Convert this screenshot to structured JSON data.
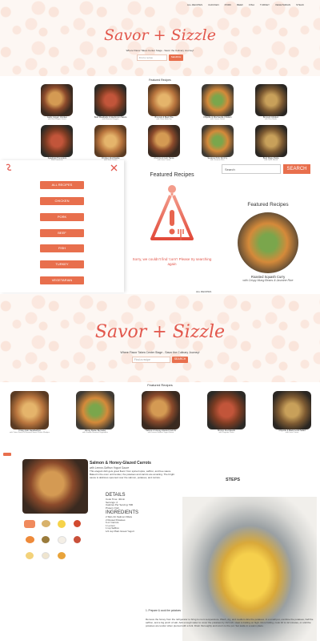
{
  "nav": {
    "items": [
      "ALL RECIPES",
      "CHICKEN",
      "PORK",
      "BEEF",
      "FISH",
      "TURKEY",
      "VEGETARIAN",
      "STEAK"
    ]
  },
  "hero": {
    "logo": "Savor + Sizzle",
    "tagline": "Where Flavor Takes Center Stage - Savor the Culinary Journey!",
    "search_placeholder": "Find a recipe",
    "search_button": "SEARCH"
  },
  "featured_title": "Featured Recipes",
  "grid1": [
    {
      "title": "Garlic Ginger Chicken",
      "sub": "with Red Pepper Sauce"
    },
    {
      "title": "Beef Meatballs & Mushroom Sauce",
      "sub": "with Roasted Veggies"
    },
    {
      "title": "Broccoli & Beef Pita",
      "sub": "with Chive Herb Dip"
    },
    {
      "title": "Chipotle & Mozzarella Chicken",
      "sub": "with Caesar Salad"
    },
    {
      "title": "Broccoli Chicken",
      "sub": "with Rice Bowls"
    },
    {
      "title": "Spaghetti Pomodoro",
      "sub": "with Parmesan"
    },
    {
      "title": "Chicken Enchiladas",
      "sub": "with Sour Cream"
    },
    {
      "title": "Chorizo & Corn Tacos",
      "sub": "with Lime Crema"
    },
    {
      "title": "Sesame Pork Stir-Fry",
      "sub": "with Jasmine Rice"
    },
    {
      "title": "Beef Ragu Pasta",
      "sub": "with Garlic Bread"
    }
  ],
  "sidebar": {
    "items": [
      "ALL RECIPES",
      "CHICKEN",
      "PORK",
      "BEEF",
      "FISH",
      "TURKEY",
      "VEGETARIAN"
    ]
  },
  "middle": {
    "search_value": "Search",
    "search_button": "SEARCH",
    "center_title": "Featured Recipes",
    "empty_message": "Sorry, we couldn't find 'corn'! Please try searching again",
    "right_title": "Featured Recipes",
    "right_card_title": "Roasted Squash Curry",
    "right_card_sub": "with Crispy Mung Beans & Jasmine Rice",
    "section_label": "ALL RECIPES"
  },
  "grid2": [
    {
      "title": "Crispy Fish Sandwiches",
      "sub": "with Tartar Sauce & Roasted Sweet Potato Wedges"
    },
    {
      "title": "Honey Butter Bernaise",
      "sub": "with Garden Roasted Vegetables"
    },
    {
      "title": "Salmon & Honey-Glazed Carrots",
      "sub": "with Lemon-Saffron Yogurt Sauce"
    },
    {
      "title": "Shrimp Fra Diavolo",
      "sub": "with Linguine Pasta"
    },
    {
      "title": "Chipotle & Black Lentil Salad",
      "sub": "with Lime Crema"
    }
  ],
  "detail": {
    "title": "Salmon & Honey-Glazed Carrots",
    "subtitle": "with Lemon-Saffron Yogurt Sauce",
    "description": "This elegant dish gets great flavor from spiced spice, saffron, and bee sauce. Baked in the oven until tender, the potatoes and carrots are amazing. The bright sauce is delicious spooned over the salmon, potatoes, and carrots.",
    "details_heading": "DETAILS",
    "details": [
      "Cook Time: 40min",
      "Servings: 2",
      "Calories Per Serving: 590",
      "Protein: Fish"
    ],
    "ingredients_heading": "INGREDIENTS",
    "ingredients": [
      "2 Skin-On Salmon Fillets",
      "2 Russet Potatoes",
      "6 oz Carrots",
      "1 Lemon",
      "1 tsp Saffron",
      "1/2 cup Plain Greek Yogurt"
    ],
    "steps_heading": "STEPS",
    "step_caption": "1. Prepare & cook the potatoes",
    "step_text": "Remove the honey from the refrigerator to bring to room temperature. Wash, dry, and medium dice the potatoes. In a small pot, combine the potatoes, half the saffron, and a big pinch of salt. Add enough water to cover the potatoes by 1/2 inch. Heat to boiling on high. Once boiling, cook 10 to 12 minutes, or until the potatoes are tender when pierced with a fork. Drain thoroughly and return to the pot. Set aside in a warm place."
  }
}
